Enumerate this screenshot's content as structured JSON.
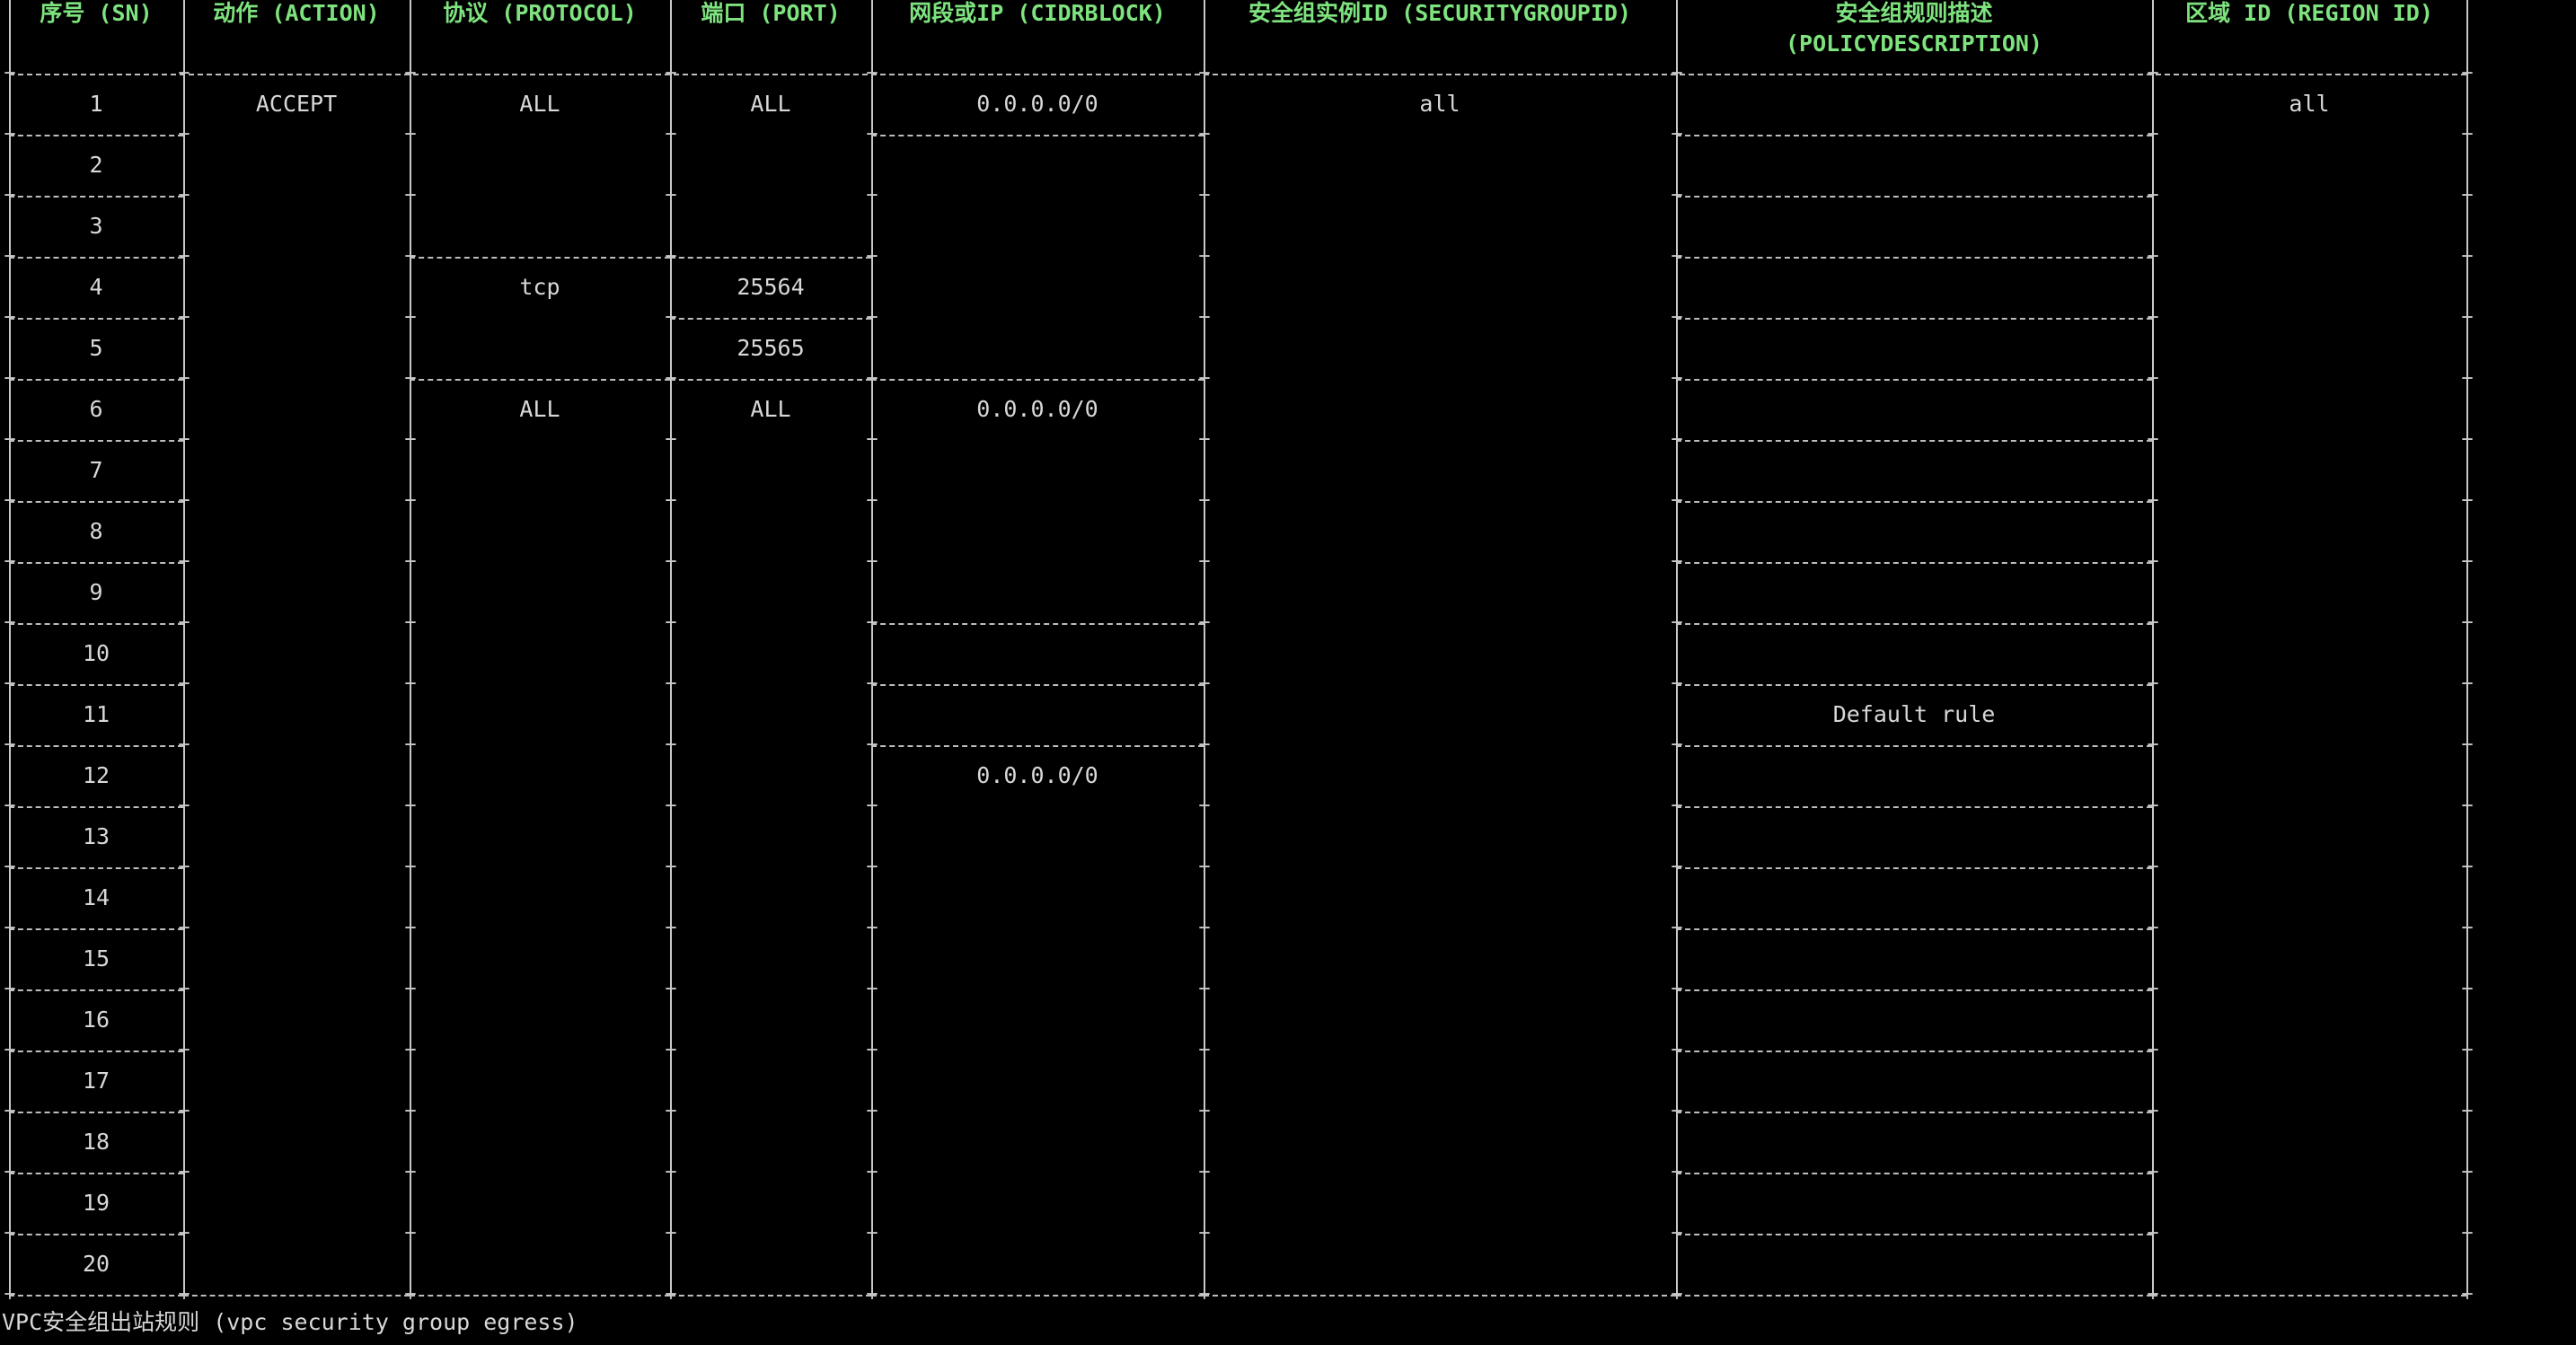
{
  "headers": [
    {
      "key": "sn",
      "lines": [
        "序号 (SN)"
      ]
    },
    {
      "key": "action",
      "lines": [
        "动作 (ACTION)"
      ]
    },
    {
      "key": "protocol",
      "lines": [
        "协议 (PROTOCOL)"
      ]
    },
    {
      "key": "port",
      "lines": [
        "端口 (PORT)"
      ]
    },
    {
      "key": "cidr",
      "lines": [
        "网段或IP (CIDRBLOCK)"
      ]
    },
    {
      "key": "sgid",
      "lines": [
        "安全组实例ID (SECURITYGROUPID)"
      ]
    },
    {
      "key": "desc",
      "lines": [
        "安全组规则描述",
        "(POLICYDESCRIPTION)"
      ]
    },
    {
      "key": "region",
      "lines": [
        "区域 ID (REGION ID)"
      ]
    }
  ],
  "rows": [
    {
      "sn": "1",
      "action": "ACCEPT",
      "protocol": "ALL",
      "port": "ALL",
      "cidr": "0.0.0.0/0",
      "sgid": "all",
      "desc": "",
      "region": "all"
    },
    {
      "sn": "2"
    },
    {
      "sn": "3"
    },
    {
      "sn": "4",
      "protocol": "tcp",
      "port": "25564"
    },
    {
      "sn": "5",
      "port": "25565"
    },
    {
      "sn": "6",
      "protocol": "ALL",
      "port": "ALL",
      "cidr": "0.0.0.0/0"
    },
    {
      "sn": "7"
    },
    {
      "sn": "8"
    },
    {
      "sn": "9"
    },
    {
      "sn": "10"
    },
    {
      "sn": "11",
      "desc": "Default rule"
    },
    {
      "sn": "12",
      "cidr": "0.0.0.0/0"
    },
    {
      "sn": "13"
    },
    {
      "sn": "14"
    },
    {
      "sn": "15"
    },
    {
      "sn": "16"
    },
    {
      "sn": "17"
    },
    {
      "sn": "18"
    },
    {
      "sn": "19"
    },
    {
      "sn": "20"
    }
  ],
  "caption": "VPC安全组出站规则 (vpc security group egress)",
  "colors": {
    "header": "#7ee37e",
    "text": "#d8d8d8",
    "border": "#c8c8c8",
    "background": "#000000"
  }
}
